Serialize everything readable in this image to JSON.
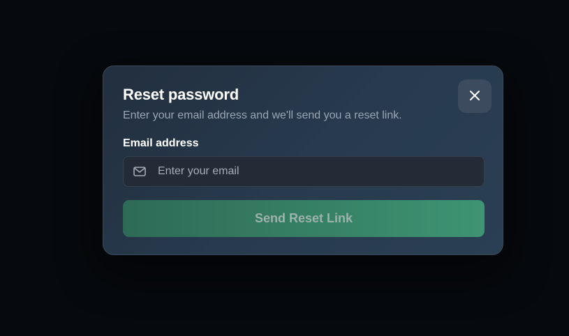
{
  "modal": {
    "title": "Reset password",
    "subtitle": "Enter your email address and we'll send you a reset link.",
    "close_icon": "close-icon",
    "email": {
      "label": "Email address",
      "placeholder": "Enter your email",
      "value": "",
      "icon": "mail-icon"
    },
    "submit_label": "Send Reset Link"
  },
  "colors": {
    "background": "#06090d",
    "modal_bg": "#273a4e",
    "button_accent": "#367f64",
    "close_bg": "#3c4c5e"
  }
}
